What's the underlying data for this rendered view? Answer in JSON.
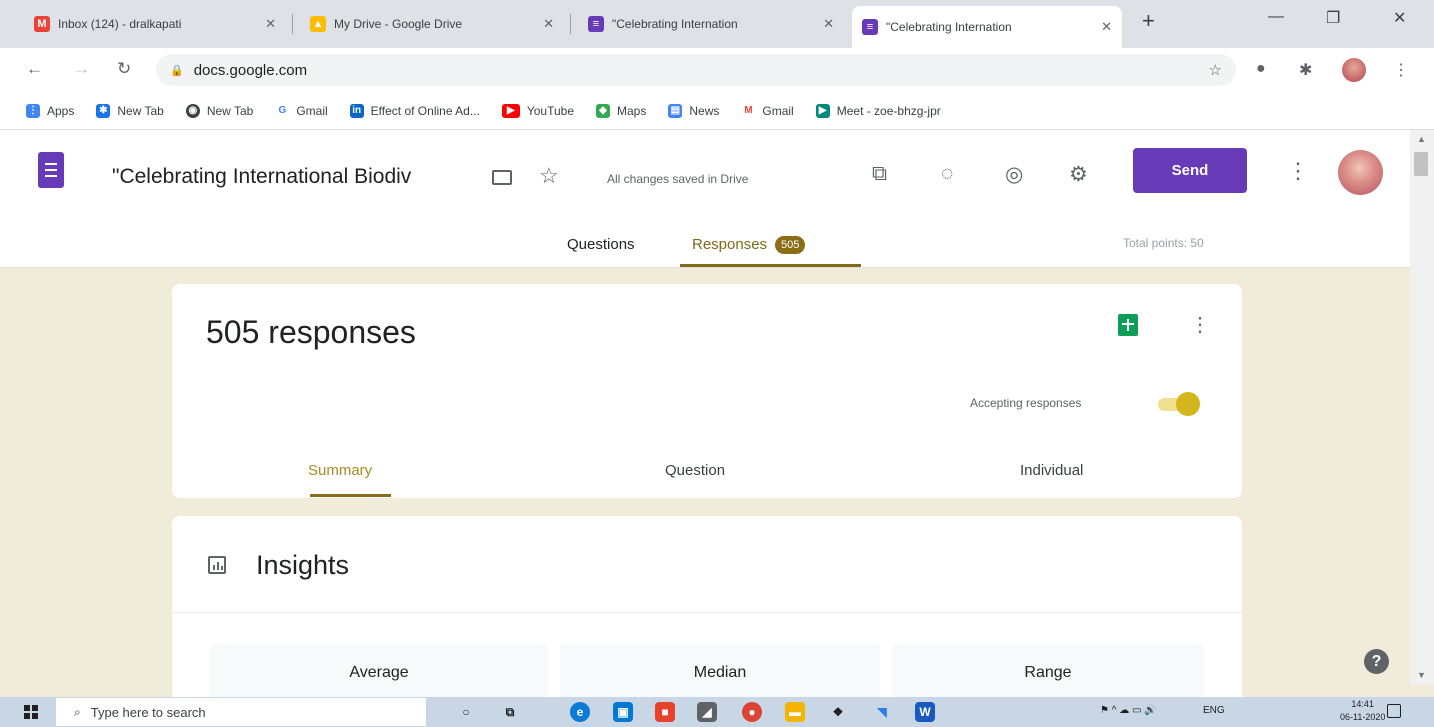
{
  "browser": {
    "tabs": [
      {
        "title": "Inbox (124) - dralkapati",
        "icon": "gmail-icon",
        "color": "#ea4335",
        "glyph": "M"
      },
      {
        "title": "My Drive - Google Drive",
        "icon": "drive-icon",
        "color": "#fbbc04",
        "glyph": "▲"
      },
      {
        "title": "\"Celebrating Internation",
        "icon": "forms-icon",
        "color": "#673ab7",
        "glyph": "≡"
      },
      {
        "title": "\"Celebrating Internation",
        "icon": "forms-icon",
        "color": "#673ab7",
        "glyph": "≡"
      }
    ],
    "url": "docs.google.com",
    "bookmarks": [
      {
        "label": "Apps",
        "icon": "apps-grid-icon",
        "color": "#4285f4",
        "glyph": "⋮"
      },
      {
        "label": "New Tab",
        "icon": "gear-icon",
        "color": "#1a73e8",
        "glyph": "✱"
      },
      {
        "label": "New Tab",
        "icon": "globe-icon",
        "color": "#3c4043",
        "glyph": "◉"
      },
      {
        "label": "Gmail",
        "icon": "google-icon",
        "color": "#4285f4",
        "glyph": "G"
      },
      {
        "label": "Effect of Online Ad...",
        "icon": "linkedin-icon",
        "color": "#0a66c2",
        "glyph": "in"
      },
      {
        "label": "YouTube",
        "icon": "youtube-icon",
        "color": "#ff0000",
        "glyph": "▶"
      },
      {
        "label": "Maps",
        "icon": "maps-icon",
        "color": "#34a853",
        "glyph": "◆"
      },
      {
        "label": "News",
        "icon": "news-icon",
        "color": "#4285f4",
        "glyph": "▤"
      },
      {
        "label": "Gmail",
        "icon": "gmail-icon",
        "color": "#ea4335",
        "glyph": "M"
      },
      {
        "label": "Meet - zoe-bhzg-jpr",
        "icon": "meet-icon",
        "color": "#00897b",
        "glyph": "▶"
      }
    ]
  },
  "form": {
    "title": "\"Celebrating International Biodiv",
    "saved_status": "All changes saved in Drive",
    "send_label": "Send",
    "tabs": {
      "questions": "Questions",
      "responses": "Responses",
      "responses_count": "505"
    },
    "total_points": "Total points: 50",
    "accent_color": "#673ab7"
  },
  "responses": {
    "count_label": "505 responses",
    "accepting_label": "Accepting responses",
    "accepting": true,
    "subtabs": {
      "summary": "Summary",
      "question": "Question",
      "individual": "Individual"
    }
  },
  "insights": {
    "title": "Insights",
    "stats": {
      "average": "Average",
      "median": "Median",
      "range": "Range"
    }
  },
  "taskbar": {
    "search_placeholder": "Type here to search",
    "language": "ENG",
    "time": "14:41",
    "date": "06-11-2020"
  }
}
